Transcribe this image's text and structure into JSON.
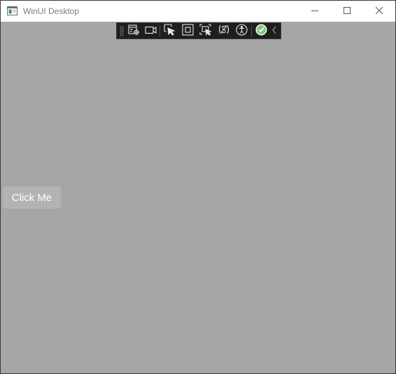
{
  "window": {
    "title": "WinUI Desktop",
    "icons": {
      "app": "app-window-icon",
      "minimize": "minimize-icon",
      "maximize": "maximize-icon",
      "close": "close-icon"
    }
  },
  "debug_toolbar": {
    "icons": [
      "live-visual-tree-icon",
      "record-video-icon",
      "select-element-icon",
      "display-layout-adorners-icon",
      "track-focused-element-icon",
      "hot-reload-icon",
      "accessibility-checker-icon",
      "no-issues-check-icon",
      "collapse-chevron-icon"
    ],
    "colors": {
      "background": "#1e1e1e",
      "icon": "#e6e6e6",
      "check": "#8fd48f"
    }
  },
  "content": {
    "button_label": "Click Me",
    "background": "#a6a6a6"
  }
}
